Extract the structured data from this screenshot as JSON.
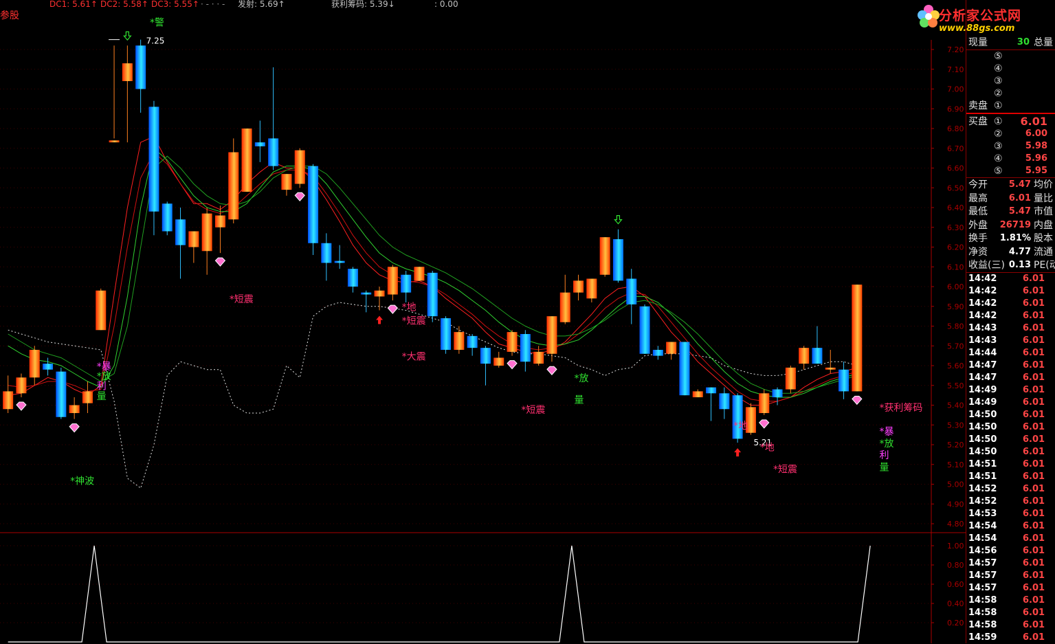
{
  "header": {
    "left_label": "参股",
    "items": [
      {
        "text": "DC1: 5.61↑",
        "color": "#ff3030"
      },
      {
        "text": "DC2: 5.58↑",
        "color": "#ff3030"
      },
      {
        "text": "DC3: 5.55↑",
        "color": "#ff3030"
      },
      {
        "text": "· - · · -",
        "color": "#909090"
      },
      {
        "text": "发射: 5.69↑",
        "color": "#c0c0c0"
      },
      {
        "text": "获利筹码: 5.39↓",
        "color": "#c0c0c0"
      },
      {
        "text": ": 0.00",
        "color": "#c0c0c0"
      }
    ]
  },
  "colors": {
    "up_gradient_a": "#ff2a00",
    "up_gradient_b": "#ffd040",
    "down_gradient_a": "#0060ff",
    "down_gradient_b": "#30e0ff",
    "ma_red": "#ff2020",
    "ma_green": "#30c030",
    "dotted": "#e0e0e0",
    "axis": "#aa0000",
    "signal_pink": "#ff3070",
    "signal_green": "#30e030"
  },
  "chart_data": [
    {
      "type": "candlestick",
      "ylim": [
        4.75,
        7.25
      ],
      "yticks": [
        "7.20",
        "7.10",
        "7.00",
        "6.90",
        "6.80",
        "6.70",
        "6.60",
        "6.50",
        "6.40",
        "6.30",
        "6.20",
        "6.10",
        "6.00",
        "5.90",
        "5.80",
        "5.70",
        "5.60",
        "5.50",
        "5.40",
        "5.30",
        "5.20",
        "5.10",
        "5.00",
        "4.90",
        "4.80"
      ],
      "annotations": [
        {
          "text": "7.25",
          "color": "#ffffff"
        },
        {
          "text": "5.21",
          "color": "#ffffff"
        }
      ],
      "candles": [
        {
          "o": 5.38,
          "c": 5.47,
          "h": 5.55,
          "l": 5.36
        },
        {
          "o": 5.46,
          "c": 5.54,
          "h": 5.56,
          "l": 5.44
        },
        {
          "o": 5.54,
          "c": 5.68,
          "h": 5.7,
          "l": 5.5
        },
        {
          "o": 5.61,
          "c": 5.58,
          "h": 5.64,
          "l": 5.55
        },
        {
          "o": 5.57,
          "c": 5.34,
          "h": 5.59,
          "l": 5.33
        },
        {
          "o": 5.36,
          "c": 5.4,
          "h": 5.44,
          "l": 5.33
        },
        {
          "o": 5.41,
          "c": 5.47,
          "h": 5.52,
          "l": 5.36
        },
        {
          "o": 5.78,
          "c": 5.98,
          "h": 5.99,
          "l": 5.78
        },
        {
          "o": 6.73,
          "c": 6.74,
          "h": 7.22,
          "l": 6.75
        },
        {
          "o": 7.04,
          "c": 7.13,
          "h": 7.22,
          "l": 6.73
        },
        {
          "o": 7.22,
          "c": 7.0,
          "h": 7.25,
          "l": 6.88
        },
        {
          "o": 6.91,
          "c": 6.38,
          "h": 6.94,
          "l": 6.26
        },
        {
          "o": 6.42,
          "c": 6.28,
          "h": 6.43,
          "l": 6.26
        },
        {
          "o": 6.34,
          "c": 6.21,
          "h": 6.4,
          "l": 6.04
        },
        {
          "o": 6.2,
          "c": 6.28,
          "h": 6.28,
          "l": 6.12
        },
        {
          "o": 6.18,
          "c": 6.37,
          "h": 6.4,
          "l": 6.06
        },
        {
          "o": 6.3,
          "c": 6.36,
          "h": 6.41,
          "l": 6.17
        },
        {
          "o": 6.34,
          "c": 6.68,
          "h": 6.75,
          "l": 6.32
        },
        {
          "o": 6.48,
          "c": 6.8,
          "h": 6.8,
          "l": 6.48
        },
        {
          "o": 6.73,
          "c": 6.71,
          "h": 6.84,
          "l": 6.63
        },
        {
          "o": 6.75,
          "c": 6.61,
          "h": 7.11,
          "l": 6.59
        },
        {
          "o": 6.49,
          "c": 6.57,
          "h": 6.57,
          "l": 6.46
        },
        {
          "o": 6.52,
          "c": 6.69,
          "h": 6.7,
          "l": 6.5
        },
        {
          "o": 6.61,
          "c": 6.22,
          "h": 6.62,
          "l": 6.16
        },
        {
          "o": 6.22,
          "c": 6.12,
          "h": 6.27,
          "l": 6.03
        },
        {
          "o": 6.13,
          "c": 6.12,
          "h": 6.21,
          "l": 6.09
        },
        {
          "o": 6.09,
          "c": 6.0,
          "h": 6.1,
          "l": 5.97
        },
        {
          "o": 5.97,
          "c": 5.96,
          "h": 5.98,
          "l": 5.87
        },
        {
          "o": 5.95,
          "c": 5.98,
          "h": 6.0,
          "l": 5.88
        },
        {
          "o": 5.96,
          "c": 6.1,
          "h": 6.11,
          "l": 5.93
        },
        {
          "o": 6.06,
          "c": 5.97,
          "h": 6.08,
          "l": 5.92
        },
        {
          "o": 6.03,
          "c": 6.1,
          "h": 6.1,
          "l": 6.03
        },
        {
          "o": 6.07,
          "c": 5.85,
          "h": 6.08,
          "l": 5.82
        },
        {
          "o": 5.84,
          "c": 5.68,
          "h": 5.85,
          "l": 5.66
        },
        {
          "o": 5.68,
          "c": 5.77,
          "h": 5.8,
          "l": 5.66
        },
        {
          "o": 5.75,
          "c": 5.69,
          "h": 5.76,
          "l": 5.65
        },
        {
          "o": 5.69,
          "c": 5.61,
          "h": 5.7,
          "l": 5.5
        },
        {
          "o": 5.6,
          "c": 5.64,
          "h": 5.67,
          "l": 5.59
        },
        {
          "o": 5.67,
          "c": 5.77,
          "h": 5.78,
          "l": 5.65
        },
        {
          "o": 5.76,
          "c": 5.62,
          "h": 5.78,
          "l": 5.57
        },
        {
          "o": 5.61,
          "c": 5.67,
          "h": 5.7,
          "l": 5.6
        },
        {
          "o": 5.66,
          "c": 5.85,
          "h": 5.85,
          "l": 5.62
        },
        {
          "o": 5.82,
          "c": 5.97,
          "h": 6.06,
          "l": 5.81
        },
        {
          "o": 5.97,
          "c": 6.03,
          "h": 6.06,
          "l": 5.93
        },
        {
          "o": 5.94,
          "c": 6.04,
          "h": 6.04,
          "l": 5.92
        },
        {
          "o": 6.06,
          "c": 6.25,
          "h": 6.25,
          "l": 6.05
        },
        {
          "o": 6.24,
          "c": 6.03,
          "h": 6.29,
          "l": 6.02
        },
        {
          "o": 6.04,
          "c": 5.91,
          "h": 6.09,
          "l": 5.81
        },
        {
          "o": 5.9,
          "c": 5.66,
          "h": 5.91,
          "l": 5.66
        },
        {
          "o": 5.68,
          "c": 5.65,
          "h": 5.7,
          "l": 5.63
        },
        {
          "o": 5.66,
          "c": 5.72,
          "h": 5.72,
          "l": 5.63
        },
        {
          "o": 5.72,
          "c": 5.45,
          "h": 5.72,
          "l": 5.45
        },
        {
          "o": 5.44,
          "c": 5.47,
          "h": 5.48,
          "l": 5.44
        },
        {
          "o": 5.49,
          "c": 5.46,
          "h": 5.49,
          "l": 5.32
        },
        {
          "o": 5.46,
          "c": 5.38,
          "h": 5.49,
          "l": 5.33
        },
        {
          "o": 5.45,
          "c": 5.23,
          "h": 5.46,
          "l": 5.21
        },
        {
          "o": 5.26,
          "c": 5.39,
          "h": 5.41,
          "l": 5.25
        },
        {
          "o": 5.36,
          "c": 5.46,
          "h": 5.48,
          "l": 5.35
        },
        {
          "o": 5.48,
          "c": 5.44,
          "h": 5.49,
          "l": 5.4
        },
        {
          "o": 5.48,
          "c": 5.59,
          "h": 5.6,
          "l": 5.46
        },
        {
          "o": 5.61,
          "c": 5.69,
          "h": 5.7,
          "l": 5.58
        },
        {
          "o": 5.69,
          "c": 5.61,
          "h": 5.8,
          "l": 5.61
        },
        {
          "o": 5.58,
          "c": 5.59,
          "h": 5.68,
          "l": 5.56
        },
        {
          "o": 5.58,
          "c": 5.47,
          "h": 5.62,
          "l": 5.43
        },
        {
          "o": 5.47,
          "c": 6.01,
          "h": 6.01,
          "l": 5.47
        }
      ],
      "ma_red_1": [
        5.45,
        5.46,
        5.5,
        5.54,
        5.52,
        5.48,
        5.45,
        5.5,
        5.96,
        6.4,
        6.73,
        6.76,
        6.63,
        6.52,
        6.42,
        6.42,
        6.39,
        6.44,
        6.52,
        6.58,
        6.63,
        6.6,
        6.6,
        6.54,
        6.44,
        6.33,
        6.21,
        6.12,
        6.06,
        6.03,
        6.02,
        6.03,
        6.0,
        5.94,
        5.89,
        5.84,
        5.77,
        5.71,
        5.69,
        5.67,
        5.66,
        5.68,
        5.72,
        5.79,
        5.86,
        5.94,
        5.99,
        6.0,
        5.95,
        5.86,
        5.77,
        5.7,
        5.62,
        5.56,
        5.5,
        5.44,
        5.4,
        5.4,
        5.42,
        5.44,
        5.49,
        5.53,
        5.56,
        5.57,
        5.59
      ],
      "ma_red_2": [
        5.5,
        5.49,
        5.5,
        5.52,
        5.52,
        5.5,
        5.47,
        5.48,
        5.8,
        6.2,
        6.55,
        6.68,
        6.62,
        6.52,
        6.43,
        6.39,
        6.37,
        6.4,
        6.46,
        6.52,
        6.57,
        6.59,
        6.59,
        6.56,
        6.47,
        6.37,
        6.26,
        6.17,
        6.1,
        6.06,
        6.03,
        6.02,
        6.0,
        5.96,
        5.91,
        5.86,
        5.8,
        5.75,
        5.71,
        5.69,
        5.68,
        5.69,
        5.71,
        5.76,
        5.82,
        5.89,
        5.94,
        5.97,
        5.96,
        5.9,
        5.82,
        5.74,
        5.66,
        5.59,
        5.53,
        5.47,
        5.43,
        5.42,
        5.42,
        5.44,
        5.47,
        5.5,
        5.53,
        5.55,
        5.57
      ],
      "ma_green_1": [
        5.7,
        5.66,
        5.63,
        5.62,
        5.6,
        5.56,
        5.52,
        5.49,
        5.6,
        5.95,
        6.4,
        6.7,
        6.64,
        6.55,
        6.46,
        6.4,
        6.38,
        6.38,
        6.42,
        6.5,
        6.58,
        6.61,
        6.61,
        6.59,
        6.52,
        6.43,
        6.34,
        6.25,
        6.17,
        6.12,
        6.09,
        6.07,
        6.05,
        6.02,
        5.98,
        5.93,
        5.88,
        5.82,
        5.77,
        5.73,
        5.71,
        5.7,
        5.71,
        5.73,
        5.78,
        5.84,
        5.9,
        5.95,
        5.95,
        5.92,
        5.86,
        5.79,
        5.71,
        5.64,
        5.57,
        5.51,
        5.47,
        5.45,
        5.44,
        5.44,
        5.46,
        5.49,
        5.52,
        5.54,
        5.56
      ],
      "ma_green_2": [
        5.76,
        5.72,
        5.68,
        5.66,
        5.64,
        5.6,
        5.56,
        5.52,
        5.56,
        5.8,
        6.2,
        6.6,
        6.66,
        6.6,
        6.52,
        6.46,
        6.42,
        6.41,
        6.43,
        6.48,
        6.55,
        6.59,
        6.61,
        6.61,
        6.57,
        6.5,
        6.42,
        6.34,
        6.26,
        6.2,
        6.16,
        6.13,
        6.1,
        6.07,
        6.03,
        5.99,
        5.94,
        5.89,
        5.84,
        5.8,
        5.77,
        5.75,
        5.75,
        5.76,
        5.79,
        5.83,
        5.88,
        5.92,
        5.93,
        5.91,
        5.87,
        5.82,
        5.76,
        5.69,
        5.62,
        5.56,
        5.51,
        5.48,
        5.46,
        5.46,
        5.47,
        5.49,
        5.51,
        5.53,
        5.55
      ],
      "dotted_line": [
        5.78,
        5.76,
        5.74,
        5.72,
        5.71,
        5.7,
        5.69,
        5.68,
        5.42,
        5.03,
        4.98,
        5.2,
        5.55,
        5.62,
        5.6,
        5.58,
        5.58,
        5.4,
        5.36,
        5.36,
        5.38,
        5.6,
        5.54,
        5.85,
        5.9,
        5.92,
        5.91,
        5.9,
        5.9,
        5.89,
        5.88,
        5.86,
        5.84,
        5.82,
        5.78,
        5.75,
        5.72,
        5.69,
        5.67,
        5.66,
        5.66,
        5.65,
        5.64,
        5.6,
        5.58,
        5.55,
        5.58,
        5.59,
        5.65,
        5.66,
        5.66,
        5.66,
        5.65,
        5.64,
        5.6,
        5.58,
        5.56,
        5.55,
        5.55,
        5.56,
        5.58,
        5.6,
        5.62,
        5.62,
        5.6
      ],
      "signals": [
        {
          "text": "*神波",
          "i": 5,
          "y": 5.0,
          "color": "#30e030"
        },
        {
          "text": "*暴",
          "i": 7,
          "y": 5.58,
          "color": "#ff40ff"
        },
        {
          "text": "*放",
          "i": 7,
          "y": 5.53,
          "color": "#30e030"
        },
        {
          "text": "利",
          "i": 7,
          "y": 5.48,
          "color": "#ff40ff"
        },
        {
          "text": "量",
          "i": 7,
          "y": 5.43,
          "color": "#30e030"
        },
        {
          "text": "*警",
          "i": 11,
          "y": 7.32,
          "color": "#30e030"
        },
        {
          "text": "*短震",
          "i": 17,
          "y": 5.92,
          "color": "#ff3070"
        },
        {
          "text": "*地",
          "i": 30,
          "y": 5.88,
          "color": "#ff3070"
        },
        {
          "text": "*短震",
          "i": 30,
          "y": 5.81,
          "color": "#ff3070"
        },
        {
          "text": "*大震",
          "i": 30,
          "y": 5.63,
          "color": "#ff3070"
        },
        {
          "text": "*短震",
          "i": 39,
          "y": 5.36,
          "color": "#ff3070"
        },
        {
          "text": "*放",
          "i": 43,
          "y": 5.52,
          "color": "#30e030"
        },
        {
          "text": "量",
          "i": 43,
          "y": 5.41,
          "color": "#30e030"
        },
        {
          "text": "*地",
          "i": 55,
          "y": 5.28,
          "color": "#ff3070"
        },
        {
          "text": "*地",
          "i": 57,
          "y": 5.17,
          "color": "#ff3070"
        },
        {
          "text": "*短震",
          "i": 58,
          "y": 5.06,
          "color": "#ff3070"
        },
        {
          "text": "*获利筹码",
          "i": 66,
          "y": 5.37,
          "color": "#ff3070"
        },
        {
          "text": "*暴",
          "i": 66,
          "y": 5.25,
          "color": "#ff40ff"
        },
        {
          "text": "*放",
          "i": 66,
          "y": 5.19,
          "color": "#30e030"
        },
        {
          "text": "利",
          "i": 66,
          "y": 5.13,
          "color": "#ff40ff"
        },
        {
          "text": "量",
          "i": 66,
          "y": 5.07,
          "color": "#30e030"
        }
      ],
      "gems": [
        1,
        5,
        16,
        22,
        29,
        38,
        41,
        57,
        64
      ],
      "up_arrows": [
        28,
        55
      ],
      "down_arrows": [
        9,
        46
      ]
    },
    {
      "type": "line",
      "ylim": [
        0,
        1.1
      ],
      "yticks": [
        "1.00",
        "0.80",
        "0.60",
        "0.40",
        "0.20"
      ],
      "spikes": [
        6.5,
        42.5,
        65
      ],
      "color": "#ffffff"
    }
  ],
  "panel": {
    "vol_label": "现量",
    "vol_value": "30",
    "total_label": "总量",
    "sell_label": "卖盘",
    "buy_label": "买盘",
    "sell_levels": [
      "⑤",
      "④",
      "③",
      "②",
      "①"
    ],
    "buy_levels": [
      {
        "n": "①",
        "p": "6.01"
      },
      {
        "n": "②",
        "p": "6.00"
      },
      {
        "n": "③",
        "p": "5.98"
      },
      {
        "n": "④",
        "p": "5.96"
      },
      {
        "n": "⑤",
        "p": "5.95"
      }
    ],
    "stats": [
      {
        "l": "今开",
        "v": "5.47",
        "vc": "red",
        "r": "均价"
      },
      {
        "l": "最高",
        "v": "6.01",
        "vc": "red",
        "r": "量比"
      },
      {
        "l": "最低",
        "v": "5.47",
        "vc": "red",
        "r": "市值"
      },
      {
        "l": "外盘",
        "v": "26719",
        "vc": "red",
        "r": "内盘"
      },
      {
        "l": "换手",
        "v": "1.81%",
        "vc": "white",
        "r": "股本"
      },
      {
        "l": "净资",
        "v": "4.77",
        "vc": "white",
        "r": "流通"
      },
      {
        "l": "收益(三)",
        "v": "0.13",
        "vc": "white",
        "r": "PE(动"
      }
    ],
    "trades": [
      {
        "t": "14:42",
        "p": "6.01"
      },
      {
        "t": "14:42",
        "p": "6.01"
      },
      {
        "t": "14:42",
        "p": "6.01"
      },
      {
        "t": "14:42",
        "p": "6.01"
      },
      {
        "t": "14:43",
        "p": "6.01"
      },
      {
        "t": "14:43",
        "p": "6.01"
      },
      {
        "t": "14:44",
        "p": "6.01"
      },
      {
        "t": "14:47",
        "p": "6.01"
      },
      {
        "t": "14:47",
        "p": "6.01"
      },
      {
        "t": "14:49",
        "p": "6.01"
      },
      {
        "t": "14:49",
        "p": "6.01"
      },
      {
        "t": "14:50",
        "p": "6.01"
      },
      {
        "t": "14:50",
        "p": "6.01"
      },
      {
        "t": "14:50",
        "p": "6.01"
      },
      {
        "t": "14:50",
        "p": "6.01"
      },
      {
        "t": "14:51",
        "p": "6.01"
      },
      {
        "t": "14:51",
        "p": "6.01"
      },
      {
        "t": "14:52",
        "p": "6.01"
      },
      {
        "t": "14:52",
        "p": "6.01"
      },
      {
        "t": "14:53",
        "p": "6.01"
      },
      {
        "t": "14:54",
        "p": "6.01"
      },
      {
        "t": "14:54",
        "p": "6.01"
      },
      {
        "t": "14:56",
        "p": "6.01"
      },
      {
        "t": "14:57",
        "p": "6.01"
      },
      {
        "t": "14:57",
        "p": "6.01"
      },
      {
        "t": "14:57",
        "p": "6.01"
      },
      {
        "t": "14:58",
        "p": "6.01"
      },
      {
        "t": "14:58",
        "p": "6.01"
      },
      {
        "t": "14:58",
        "p": "6.01"
      },
      {
        "t": "14:59",
        "p": "6.01"
      }
    ]
  },
  "logo": {
    "main": "分析家公式网",
    "sub": "www.88gs.com"
  }
}
